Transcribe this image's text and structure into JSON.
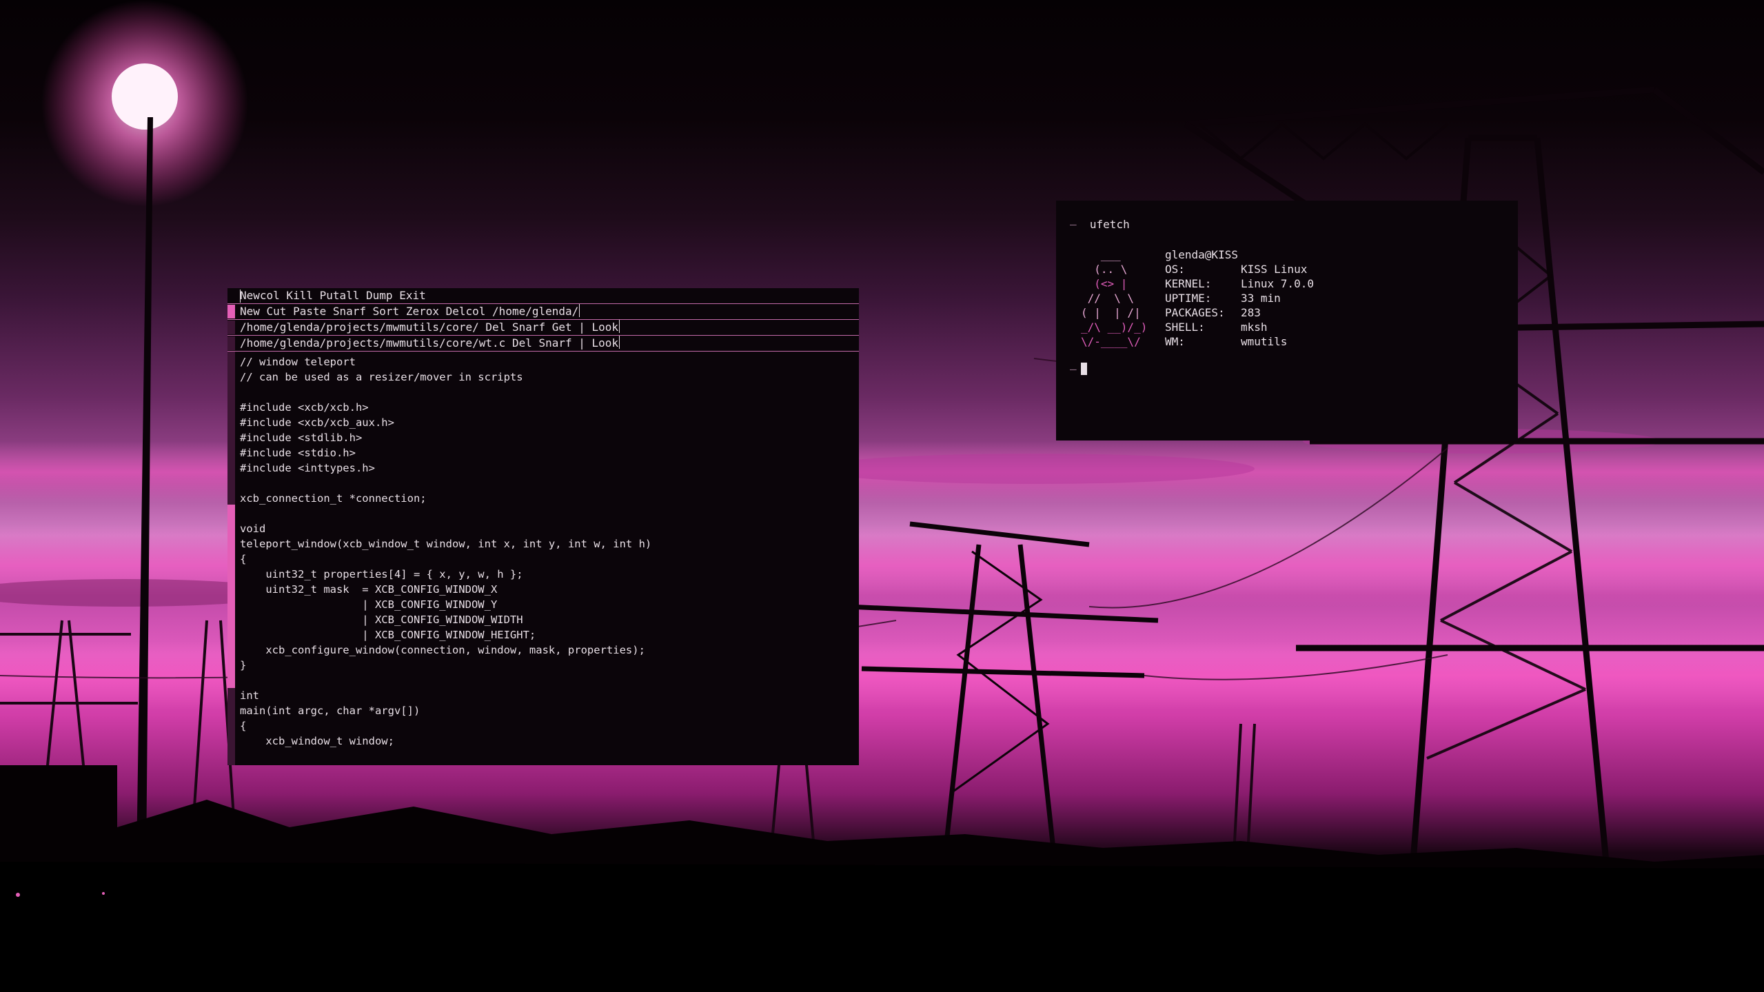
{
  "editor": {
    "main_tag": "Newcol Kill Putall Dump Exit",
    "column_tag": "New Cut Paste Snarf Sort Zerox Delcol /home/glenda/",
    "dir_window_tag": "/home/glenda/projects/mwmutils/core/ Del Snarf Get | Look",
    "file_window_tag": "/home/glenda/projects/mwmutils/core/wt.c Del Snarf | Look",
    "code": "// window teleport\n// can be used as a resizer/mover in scripts\n\n#include <xcb/xcb.h>\n#include <xcb/xcb_aux.h>\n#include <stdlib.h>\n#include <stdio.h>\n#include <inttypes.h>\n\nxcb_connection_t *connection;\n\nvoid\nteleport_window(xcb_window_t window, int x, int y, int w, int h)\n{\n    uint32_t properties[4] = { x, y, w, h };\n    uint32_t mask  = XCB_CONFIG_WINDOW_X\n                   | XCB_CONFIG_WINDOW_Y\n                   | XCB_CONFIG_WINDOW_WIDTH\n                   | XCB_CONFIG_WINDOW_HEIGHT;\n    xcb_configure_window(connection, window, mask, properties);\n}\n\nint\nmain(int argc, char *argv[])\n{\n    xcb_window_t window;"
  },
  "terminal": {
    "prompt": "—",
    "command": "ufetch",
    "ascii_art": [
      "   ___",
      "  (.. \\",
      "  (<> |",
      " //  \\ \\",
      "( |  | /|",
      "_/\\ __)/_)",
      "\\/-____\\/"
    ],
    "user_host": "glenda@KISS",
    "info": [
      {
        "key": "OS:",
        "value": "KISS Linux"
      },
      {
        "key": "KERNEL:",
        "value": "Linux 7.0.0"
      },
      {
        "key": "UPTIME:",
        "value": "33 min"
      },
      {
        "key": "PACKAGES:",
        "value": "283"
      },
      {
        "key": "SHELL:",
        "value": "mksh"
      },
      {
        "key": "WM:",
        "value": "wmutils"
      }
    ]
  },
  "colors": {
    "accent": "#e45fb7",
    "window_bg": "#0b050a",
    "text": "#e8dfe6"
  }
}
